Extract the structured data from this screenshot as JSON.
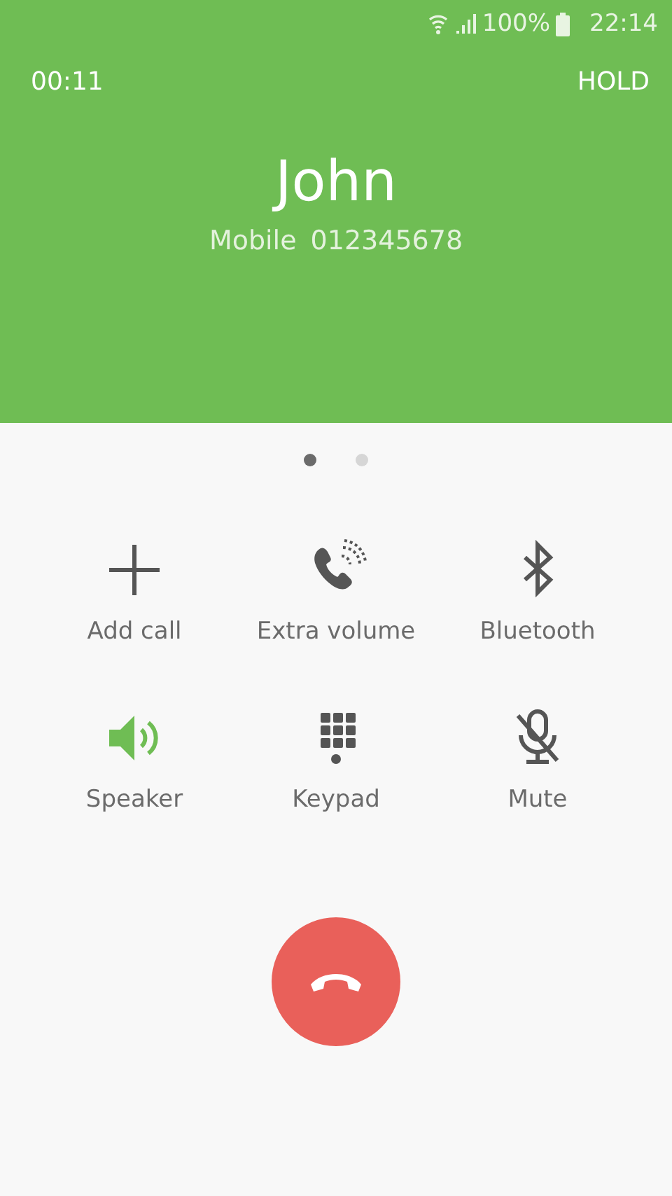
{
  "status_bar": {
    "battery": "100%",
    "time": "22:14"
  },
  "call": {
    "timer": "00:11",
    "hold": "HOLD",
    "name": "John",
    "number_label": "Mobile",
    "number": "012345678"
  },
  "pages": [
    {
      "selected": true
    },
    {
      "selected": false
    }
  ],
  "actions": [
    {
      "kind": "add",
      "label": "Add call",
      "on": false
    },
    {
      "kind": "volume",
      "label": "Extra volume",
      "on": false
    },
    {
      "kind": "bluetooth",
      "label": "Bluetooth",
      "on": false
    },
    {
      "kind": "speaker",
      "label": "Speaker",
      "on": true
    },
    {
      "kind": "keypad",
      "label": "Keypad",
      "on": false
    },
    {
      "kind": "mute",
      "label": "Mute",
      "on": false
    }
  ]
}
